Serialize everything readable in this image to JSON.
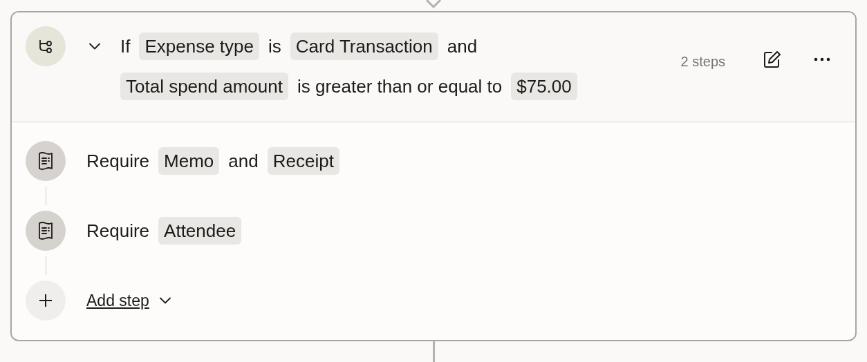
{
  "rule": {
    "expanded": true,
    "condition_lines": [
      [
        {
          "kind": "text",
          "text": "If"
        },
        {
          "kind": "token",
          "text": "Expense type"
        },
        {
          "kind": "text",
          "text": "is"
        },
        {
          "kind": "token",
          "text": "Card Transaction"
        },
        {
          "kind": "text",
          "text": "and"
        }
      ],
      [
        {
          "kind": "token",
          "text": "Total spend amount"
        },
        {
          "kind": "text",
          "text": "is greater than or equal to"
        },
        {
          "kind": "token",
          "text": "$75.00"
        }
      ]
    ],
    "step_count": "2 steps",
    "steps": [
      {
        "kind": "requirement",
        "segments": [
          {
            "kind": "text",
            "text": "Require"
          },
          {
            "kind": "token",
            "text": "Memo"
          },
          {
            "kind": "text",
            "text": "and"
          },
          {
            "kind": "token",
            "text": "Receipt"
          }
        ]
      },
      {
        "kind": "requirement",
        "segments": [
          {
            "kind": "text",
            "text": "Require"
          },
          {
            "kind": "token",
            "text": "Attendee"
          }
        ]
      },
      {
        "kind": "add",
        "label": "Add step"
      }
    ]
  }
}
